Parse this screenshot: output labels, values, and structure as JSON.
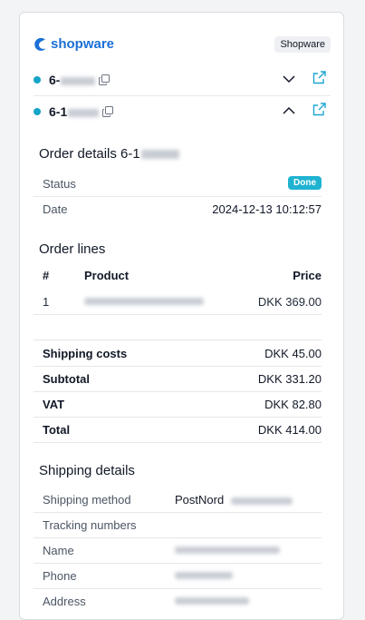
{
  "brand": {
    "logo_text": "shopware",
    "tag": "Shopware",
    "color": "#1b6fd6"
  },
  "orders": [
    {
      "id_prefix": "6-",
      "expanded": false
    },
    {
      "id_prefix": "6-1",
      "expanded": true
    }
  ],
  "order_details": {
    "title": "Order details 6-1",
    "status_label": "Status",
    "status_value": "Done",
    "date_label": "Date",
    "date_value": "2024-12-13 10:12:57"
  },
  "order_lines": {
    "title": "Order lines",
    "headers": {
      "num": "#",
      "product": "Product",
      "price": "Price"
    },
    "rows": [
      {
        "num": "1",
        "price": "DKK 369.00"
      }
    ]
  },
  "summary": [
    {
      "label": "Shipping costs",
      "value": "DKK 45.00"
    },
    {
      "label": "Subtotal",
      "value": "DKK 331.20"
    },
    {
      "label": "VAT",
      "value": "DKK 82.80"
    },
    {
      "label": "Total",
      "value": "DKK 414.00"
    }
  ],
  "shipping": {
    "title": "Shipping details",
    "method_label": "Shipping method",
    "method_value": "PostNord",
    "tracking_label": "Tracking numbers",
    "name_label": "Name",
    "phone_label": "Phone",
    "address_label": "Address"
  },
  "icons": {
    "logo": "shopware-logo-icon",
    "copy": "copy-icon",
    "expand": "chevron-down-icon",
    "collapse": "chevron-up-icon",
    "open": "external-link-icon"
  },
  "colors": {
    "status_dot": "#14a4c8",
    "badge": "#1fb3d1",
    "link_icon": "#1ea7d4"
  }
}
